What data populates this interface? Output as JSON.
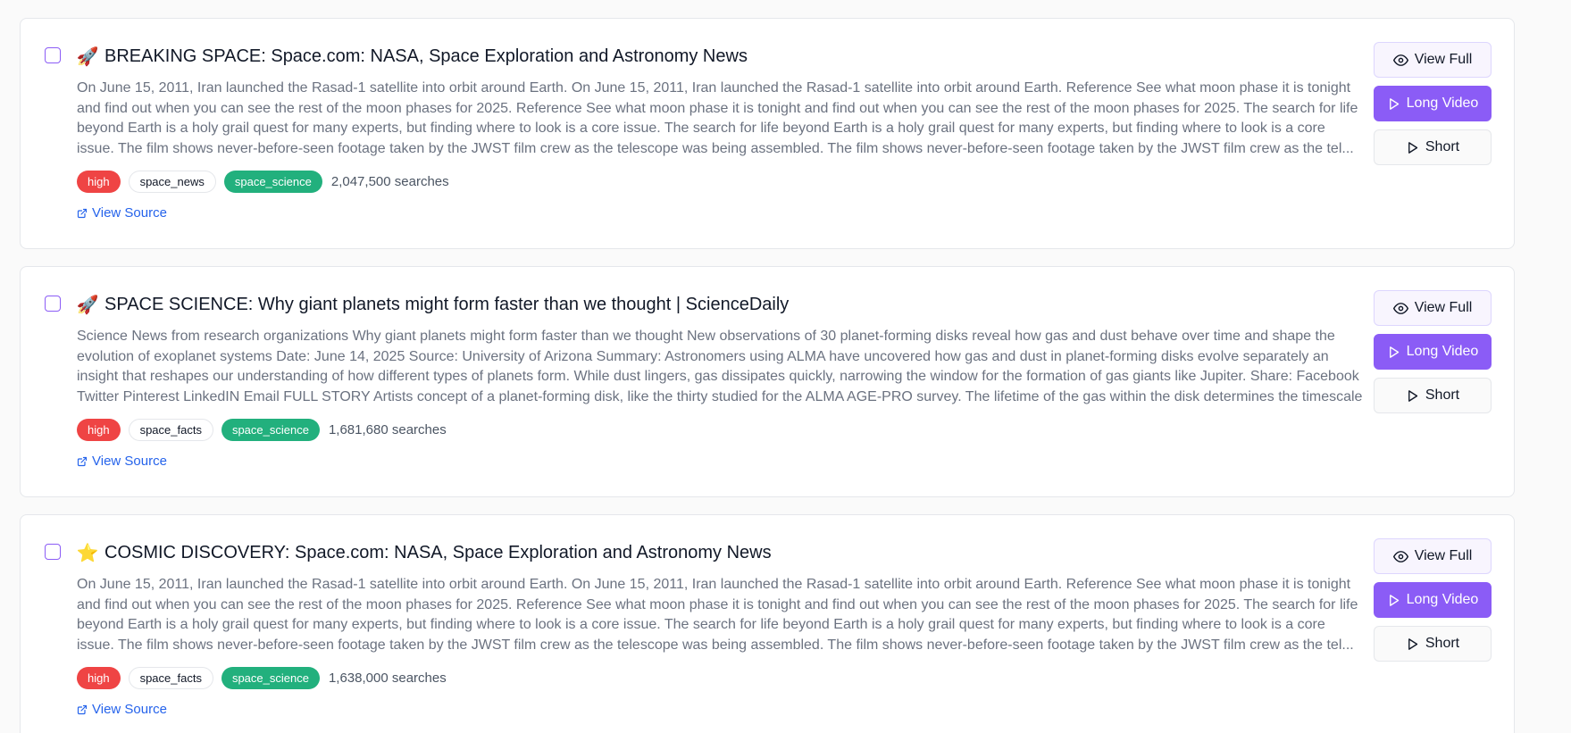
{
  "colors": {
    "accent": "#8b5cf6",
    "priority_high": "#ef4444",
    "space_science_tag": "#22b07d",
    "link": "#2563eb"
  },
  "cards": [
    {
      "emoji": "🚀",
      "title": "BREAKING SPACE: Space.com: NASA, Space Exploration and Astronomy News",
      "summary": "On June 15, 2011, Iran launched the Rasad-1 satellite into orbit around Earth. On June 15, 2011, Iran launched the Rasad-1 satellite into orbit around Earth. Reference See what moon phase it is tonight and find out when you can see the rest of the moon phases for 2025. Reference See what moon phase it is tonight and find out when you can see the rest of the moon phases for 2025. The search for life beyond Earth is a holy grail quest for many experts, but finding where to look is a core issue. The search for life beyond Earth is a holy grail quest for many experts, but finding where to look is a core issue. The film shows never-before-seen footage taken by the JWST film crew as the telescope was being assembled. The film shows never-before-seen footage taken by the JWST film crew as the tel...",
      "priority": "high",
      "category": "space_news",
      "topic": "space_science",
      "searches": "2,047,500 searches",
      "source_label": "View Source",
      "buttons": {
        "view": "View Full",
        "long": "Long Video",
        "short": "Short"
      }
    },
    {
      "emoji": "🚀",
      "title": "SPACE SCIENCE: Why giant planets might form faster than we thought | ScienceDaily",
      "summary": "Science News from research organizations Why giant planets might form faster than we thought New observations of 30 planet-forming disks reveal how gas and dust behave over time and shape the evolution of exoplanet systems Date: June 14, 2025 Source: University of Arizona Summary: Astronomers using ALMA have uncovered how gas and dust in planet-forming disks evolve separately an insight that reshapes our understanding of how different types of planets form. While dust lingers, gas dissipates quickly, narrowing the window for the formation of gas giants like Jupiter. Share: Facebook Twitter Pinterest LinkedIN Email FULL STORY Artists concept of a planet-forming disk, like the thirty studied for the ALMA AGE-PRO survey. The lifetime of the gas within the disk determines the timescale for pla...",
      "priority": "high",
      "category": "space_facts",
      "topic": "space_science",
      "searches": "1,681,680 searches",
      "source_label": "View Source",
      "buttons": {
        "view": "View Full",
        "long": "Long Video",
        "short": "Short"
      }
    },
    {
      "emoji": "⭐",
      "title": "COSMIC DISCOVERY: Space.com: NASA, Space Exploration and Astronomy News",
      "summary": "On June 15, 2011, Iran launched the Rasad-1 satellite into orbit around Earth. On June 15, 2011, Iran launched the Rasad-1 satellite into orbit around Earth. Reference See what moon phase it is tonight and find out when you can see the rest of the moon phases for 2025. Reference See what moon phase it is tonight and find out when you can see the rest of the moon phases for 2025. The search for life beyond Earth is a holy grail quest for many experts, but finding where to look is a core issue. The search for life beyond Earth is a holy grail quest for many experts, but finding where to look is a core issue. The film shows never-before-seen footage taken by the JWST film crew as the telescope was being assembled. The film shows never-before-seen footage taken by the JWST film crew as the tel...",
      "priority": "high",
      "category": "space_facts",
      "topic": "space_science",
      "searches": "1,638,000 searches",
      "source_label": "View Source",
      "buttons": {
        "view": "View Full",
        "long": "Long Video",
        "short": "Short"
      }
    }
  ]
}
